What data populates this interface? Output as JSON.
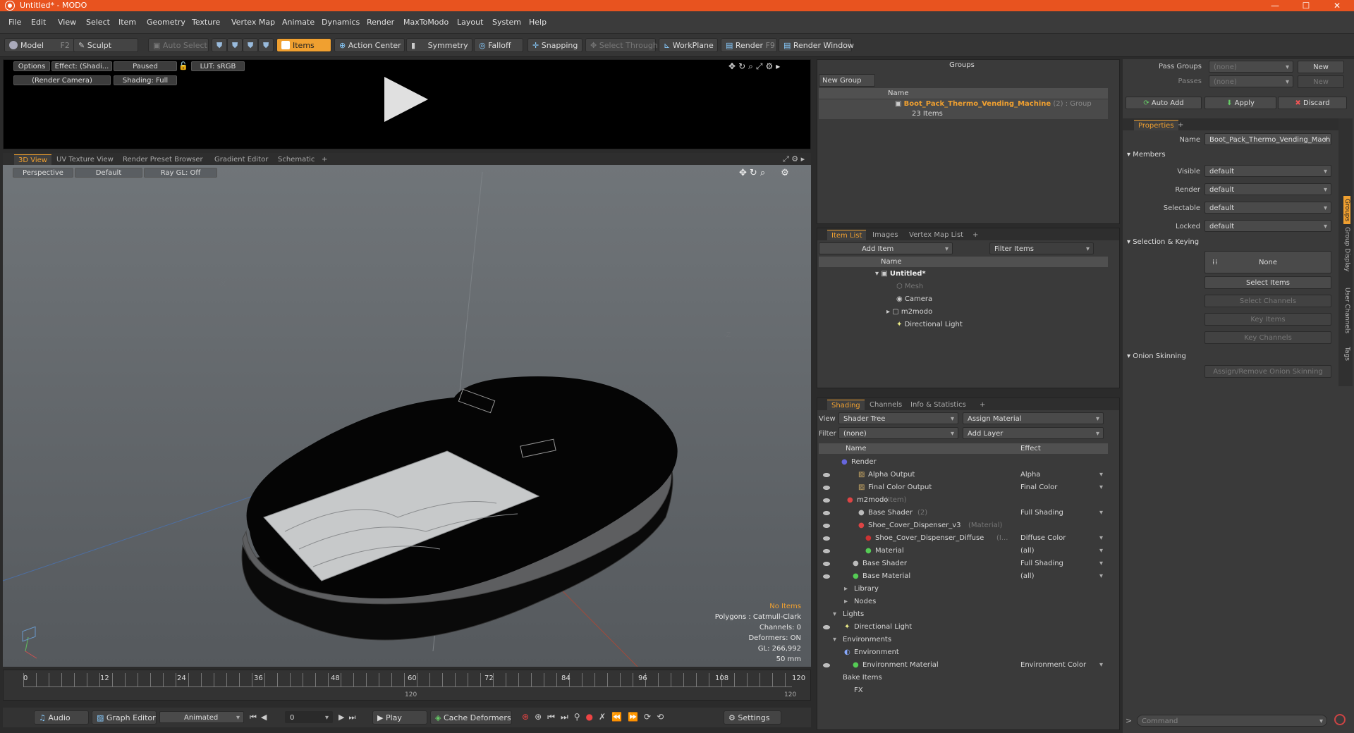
{
  "window": {
    "title": "Untitled* - MODO",
    "minimize": "—",
    "maximize": "☐",
    "close": "✕"
  },
  "menu": [
    "File",
    "Edit",
    "View",
    "Select",
    "Item",
    "Geometry",
    "Texture",
    "Vertex Map",
    "Animate",
    "Dynamics",
    "Render",
    "MaxToModo",
    "Layout",
    "System",
    "Help"
  ],
  "toolbar": {
    "model": "Model",
    "model_key": "F2",
    "sculpt": "Sculpt",
    "auto_select": "Auto Select",
    "items": "Items",
    "action_center": "Action Center",
    "symmetry": "Symmetry",
    "falloff": "Falloff",
    "snapping": "Snapping",
    "select_through": "Select Through",
    "workplane": "WorkPlane",
    "render": "Render",
    "render_key": "F9",
    "render_window": "Render Window"
  },
  "preview": {
    "options": "Options",
    "effect": "Effect: (Shadi...",
    "paused": "Paused",
    "lut": "LUT: sRGB",
    "camera": "(Render Camera)",
    "shading": "Shading: Full"
  },
  "viewport_tabs": [
    "3D View",
    "UV Texture View",
    "Render Preset Browser",
    "Gradient Editor",
    "Schematic",
    "+"
  ],
  "viewport": {
    "perspective": "Perspective",
    "default": "Default",
    "raygl": "Ray GL: Off",
    "no_items": "No Items",
    "polygons": "Polygons : Catmull-Clark",
    "channels": "Channels: 0",
    "deformers": "Deformers: ON",
    "gl": "GL: 266,992",
    "mm": "50 mm"
  },
  "timeline": {
    "ticks": [
      "0",
      "12",
      "24",
      "36",
      "48",
      "60",
      "72",
      "84",
      "96",
      "108",
      "120"
    ],
    "sub_mid": "120",
    "sub_end": "120"
  },
  "bottombar": {
    "audio": "Audio",
    "graph_editor": "Graph Editor",
    "animated": "Animated",
    "frame": "0",
    "play": "Play",
    "cache": "Cache Deformers",
    "settings": "Settings"
  },
  "groups": {
    "title": "Groups",
    "new_group": "New Group",
    "col_name": "Name",
    "item_name": "Boot_Pack_Thermo_Vending_Machine",
    "item_count": "(2) : Group",
    "item_sub": "23 Items"
  },
  "itemlist": {
    "tabs": [
      "Item List",
      "Images",
      "Vertex Map List",
      "+"
    ],
    "add_item": "Add Item",
    "filter": "Filter Items",
    "col_name": "Name",
    "rows": [
      "Untitled*",
      "Mesh",
      "Camera",
      "m2modo",
      "Directional Light"
    ]
  },
  "shading": {
    "tabs": [
      "Shading",
      "Channels",
      "Info & Statistics",
      "+"
    ],
    "view_label": "View",
    "view_value": "Shader Tree",
    "assign": "Assign Material",
    "filter_label": "Filter",
    "filter_value": "(none)",
    "add_layer": "Add Layer",
    "col_name": "Name",
    "col_effect": "Effect",
    "rows": [
      {
        "name": "Render",
        "extra": "",
        "effect": ""
      },
      {
        "name": "Alpha Output",
        "extra": "",
        "effect": "Alpha"
      },
      {
        "name": "Final Color Output",
        "extra": "",
        "effect": "Final Color"
      },
      {
        "name": "m2modo",
        "extra": "(Item)",
        "effect": ""
      },
      {
        "name": "Base Shader",
        "extra": "(2)",
        "effect": "Full Shading"
      },
      {
        "name": "Shoe_Cover_Dispenser_v3",
        "extra": "(Material)",
        "effect": ""
      },
      {
        "name": "Shoe_Cover_Dispenser_Diffuse",
        "extra": "(I...",
        "effect": "Diffuse Color"
      },
      {
        "name": "Material",
        "extra": "",
        "effect": "(all)"
      },
      {
        "name": "Base Shader",
        "extra": "",
        "effect": "Full Shading"
      },
      {
        "name": "Base Material",
        "extra": "",
        "effect": "(all)"
      },
      {
        "name": "Library",
        "extra": "",
        "effect": ""
      },
      {
        "name": "Nodes",
        "extra": "",
        "effect": ""
      },
      {
        "name": "Lights",
        "extra": "",
        "effect": ""
      },
      {
        "name": "Directional Light",
        "extra": "",
        "effect": ""
      },
      {
        "name": "Environments",
        "extra": "",
        "effect": ""
      },
      {
        "name": "Environment",
        "extra": "",
        "effect": ""
      },
      {
        "name": "Environment Material",
        "extra": "",
        "effect": "Environment Color"
      },
      {
        "name": "Bake Items",
        "extra": "",
        "effect": ""
      },
      {
        "name": "FX",
        "extra": "",
        "effect": ""
      }
    ]
  },
  "props": {
    "pass_groups": "Pass Groups",
    "passes": "Passes",
    "none": "(none)",
    "new": "New",
    "auto_add": "Auto Add",
    "apply": "Apply",
    "discard": "Discard",
    "tab": "Properties",
    "name_label": "Name",
    "name_value": "Boot_Pack_Thermo_Vending_Machin",
    "members": "Members",
    "visible": "Visible",
    "render": "Render",
    "selectable": "Selectable",
    "locked": "Locked",
    "default": "default",
    "sel_keying": "Selection & Keying",
    "none_btn": "None",
    "select_items": "Select Items",
    "select_channels": "Select Channels",
    "key_items": "Key Items",
    "key_channels": "Key Channels",
    "onion": "Onion Skinning",
    "assign_onion": "Assign/Remove Onion Skinning",
    "side_tabs": [
      "Groups",
      "Group Display",
      "User Channels",
      "Tags"
    ],
    "command": "Command"
  }
}
